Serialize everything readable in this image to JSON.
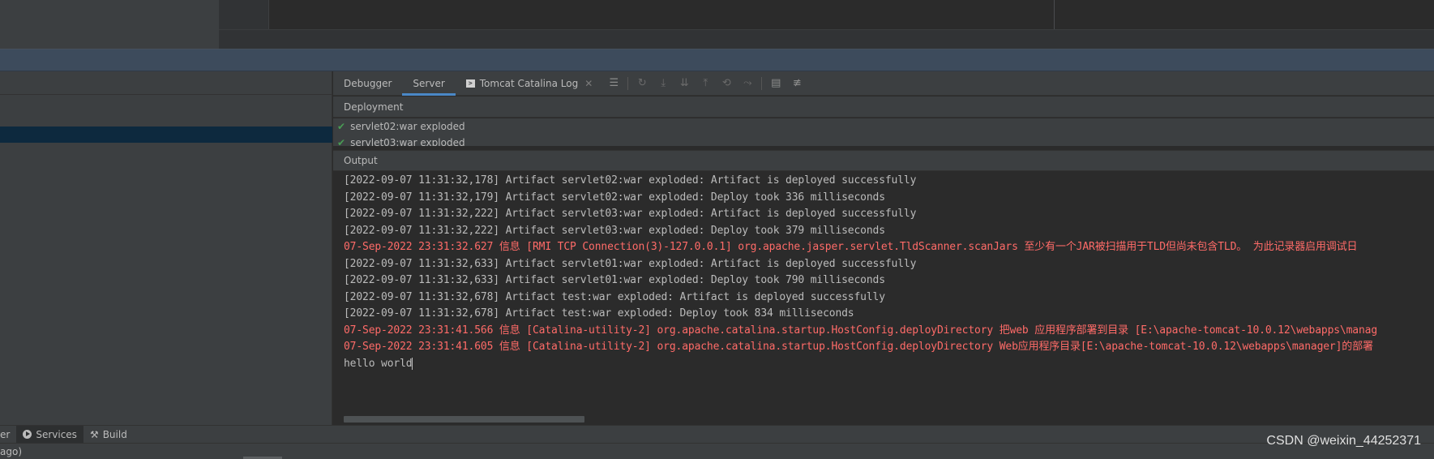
{
  "tool_window": {
    "tabs": [
      {
        "label": "Debugger"
      },
      {
        "label": "Server"
      },
      {
        "label": "Tomcat Catalina Log"
      }
    ],
    "active_tab": "Server"
  },
  "deployment": {
    "header": "Deployment",
    "items": [
      {
        "label": "servlet02:war exploded",
        "status": "deployed"
      },
      {
        "label": "servlet03:war exploded",
        "status": "deployed"
      }
    ]
  },
  "output": {
    "header": "Output",
    "lines": [
      {
        "text": "[2022-09-07 11:31:32,178] Artifact servlet02:war exploded: Artifact is deployed successfully",
        "level": "info"
      },
      {
        "text": "[2022-09-07 11:31:32,179] Artifact servlet02:war exploded: Deploy took 336 milliseconds",
        "level": "info"
      },
      {
        "text": "[2022-09-07 11:31:32,222] Artifact servlet03:war exploded: Artifact is deployed successfully",
        "level": "info"
      },
      {
        "text": "[2022-09-07 11:31:32,222] Artifact servlet03:war exploded: Deploy took 379 milliseconds",
        "level": "info"
      },
      {
        "text": "07-Sep-2022 23:31:32.627 信息 [RMI TCP Connection(3)-127.0.0.1] org.apache.jasper.servlet.TldScanner.scanJars 至少有一个JAR被扫描用于TLD但尚未包含TLD。 为此记录器启用调试日",
        "level": "error"
      },
      {
        "text": "[2022-09-07 11:31:32,633] Artifact servlet01:war exploded: Artifact is deployed successfully",
        "level": "info"
      },
      {
        "text": "[2022-09-07 11:31:32,633] Artifact servlet01:war exploded: Deploy took 790 milliseconds",
        "level": "info"
      },
      {
        "text": "[2022-09-07 11:31:32,678] Artifact test:war exploded: Artifact is deployed successfully",
        "level": "info"
      },
      {
        "text": "[2022-09-07 11:31:32,678] Artifact test:war exploded: Deploy took 834 milliseconds",
        "level": "info"
      },
      {
        "text": "07-Sep-2022 23:31:41.566 信息 [Catalina-utility-2] org.apache.catalina.startup.HostConfig.deployDirectory 把web 应用程序部署到目录 [E:\\apache-tomcat-10.0.12\\webapps\\manag",
        "level": "error"
      },
      {
        "text": "07-Sep-2022 23:31:41.605 信息 [Catalina-utility-2] org.apache.catalina.startup.HostConfig.deployDirectory Web应用程序目录[E:\\apache-tomcat-10.0.12\\webapps\\manager]的部署",
        "level": "error"
      },
      {
        "text": "hello world",
        "level": "info"
      }
    ]
  },
  "bottom_bar": {
    "items": [
      {
        "label": "er"
      },
      {
        "label": "Services",
        "icon": "services-icon"
      },
      {
        "label": "Build",
        "icon": "hammer-icon"
      }
    ]
  },
  "status_bar": {
    "text": "ago)"
  },
  "watermark": "CSDN @weixin_44252371",
  "colors": {
    "panel_bg": "#3c3f41",
    "console_bg": "#2b2b2b",
    "text": "#bbbbbb",
    "error_text": "#ff6b68",
    "accent_blue": "#4a88c7",
    "success_green": "#499c54",
    "selection": "#0d293e"
  }
}
